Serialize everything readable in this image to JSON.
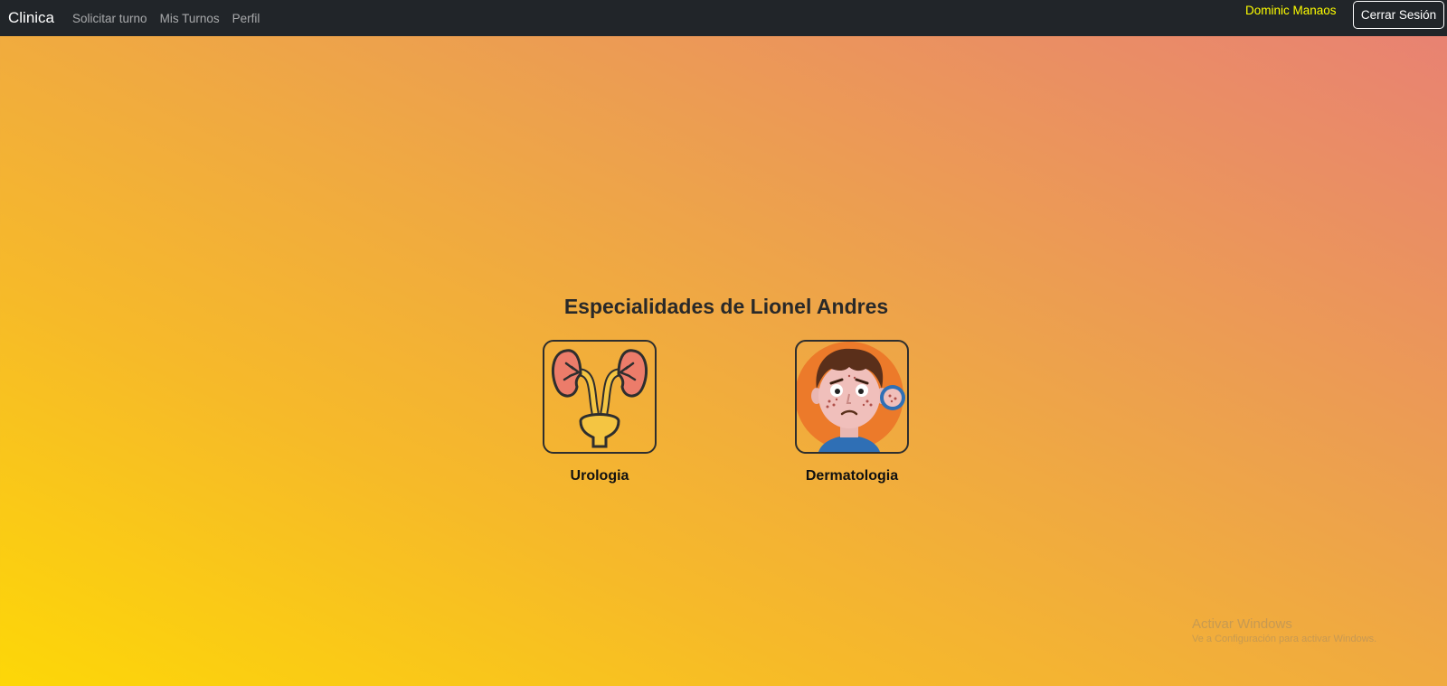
{
  "navbar": {
    "brand": "Clinica",
    "links": [
      "Solicitar turno",
      "Mis Turnos",
      "Perfil"
    ],
    "user_name": "Dominic Manaos",
    "logout_label": "Cerrar Sesión"
  },
  "main": {
    "heading": "Especialidades de Lionel Andres",
    "specialties": [
      {
        "label": "Urologia",
        "icon": "kidneys-icon"
      },
      {
        "label": "Dermatologia",
        "icon": "acne-face-icon"
      }
    ]
  },
  "watermark": {
    "title": "Activar Windows",
    "subtitle": "Ve a Configuración para activar Windows."
  },
  "colors": {
    "navbar_bg": "#212529",
    "user_name": "#ffff00",
    "gradient_start": "#fdd707",
    "gradient_end": "#e88075"
  }
}
